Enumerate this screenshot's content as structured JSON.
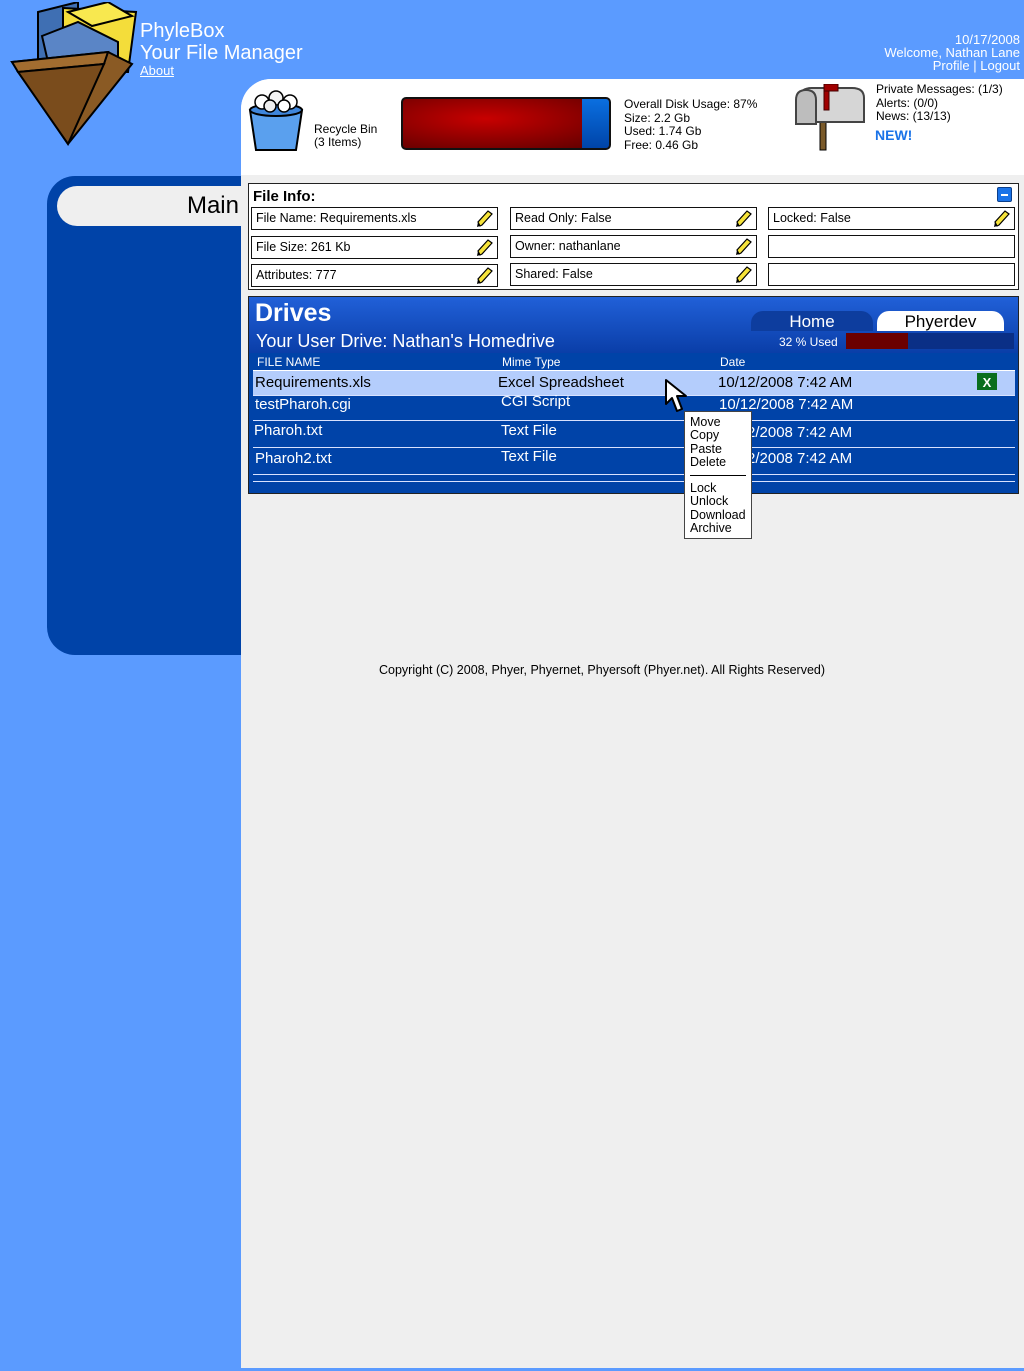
{
  "header": {
    "app_title": "PhyleBox",
    "app_subtitle": "Your File Manager",
    "about_link": "About",
    "date": "10/17/2008",
    "welcome": "Welcome, Nathan Lane",
    "profile_link": "Profile",
    "separator": "|",
    "logout_link": "Logout"
  },
  "status": {
    "recycle_bin_label": "Recycle Bin",
    "recycle_bin_items": "(3 Items)",
    "disk_usage_percent": 87,
    "disk_usage": "Overall Disk Usage: 87%",
    "disk_size": "Size: 2.2 Gb",
    "disk_used": "Used: 1.74 Gb",
    "disk_free": "Free: 0.46 Gb",
    "private_messages": "Private Messages: (1/3)",
    "alerts": "Alerts: (0/0)",
    "news": "News: (13/13)",
    "news_new": "NEW!"
  },
  "sidebar": {
    "main_tab": "Main"
  },
  "file_info": {
    "title": "File Info:",
    "file_name": "File Name: Requirements.xls",
    "read_only": "Read Only: False",
    "locked": "Locked: False",
    "file_size": "File Size: 261 Kb",
    "owner": "Owner: nathanlane",
    "attributes": "Attributes: 777",
    "shared": "Shared: False"
  },
  "drives": {
    "title": "Drives",
    "subtitle": "Your User Drive: Nathan's Homedrive",
    "tabs": [
      "Home",
      "Phyerdev"
    ],
    "used_label": "32 % Used",
    "used_percent": 32,
    "columns": [
      "FILE NAME",
      "Mime Type",
      "Date"
    ],
    "files": [
      {
        "name": "Requirements.xls",
        "type": "Excel Spreadsheet",
        "date": "10/12/2008 7:42 AM"
      },
      {
        "name": "testPharoh.cgi",
        "type": "CGI Script",
        "date": "10/12/2008 7:42 AM"
      },
      {
        "name": "Pharoh.txt",
        "type": "Text File",
        "date": "2/2008 7:42 AM"
      },
      {
        "name": "Pharoh2.txt",
        "type": "Text File",
        "date": "2/2008 7:42 AM"
      }
    ],
    "excel_badge": "X"
  },
  "context_menu": {
    "items_top": [
      "Move",
      "Copy",
      "Paste",
      "Delete"
    ],
    "items_bottom": [
      "Lock",
      "Unlock",
      "Download",
      "Archive"
    ]
  },
  "footer": {
    "copyright": "Copyright (C) 2008, Phyer, Phyernet, Phyersoft (Phyer.net). All Rights Reserved)"
  },
  "colors": {
    "background": "#5b9bff",
    "sidebar": "#0043a8",
    "selected_row": "#b4cdfc",
    "disk_used": "#a00000",
    "news_new": "#1a73e8"
  }
}
